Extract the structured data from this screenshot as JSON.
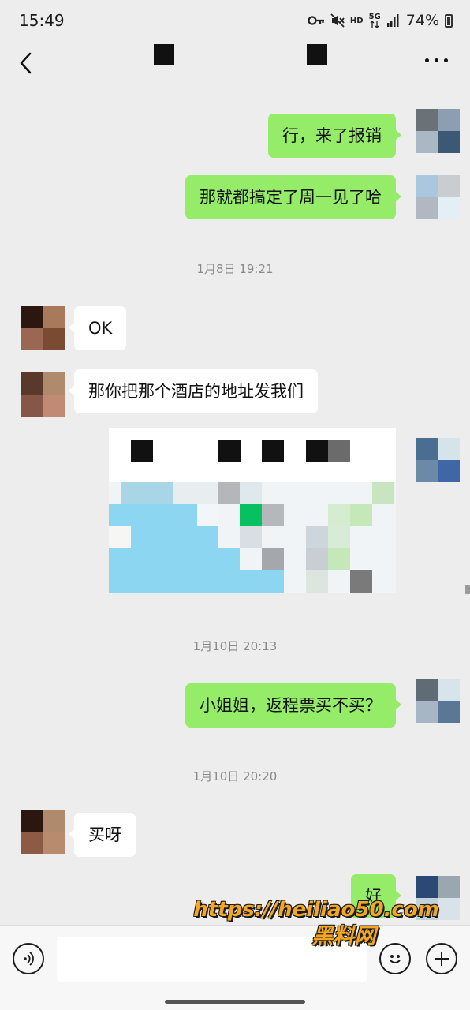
{
  "status_bar": {
    "time": "15:49",
    "network_hd": "HD",
    "network_5g": "5G",
    "battery": "74%",
    "icons": [
      "key-icon",
      "mute-icon",
      "hd-icon",
      "5g-icon",
      "signal-icon",
      "battery-icon"
    ]
  },
  "header": {
    "back_icon": "chevron-left-icon",
    "more_icon": "more-dots-icon"
  },
  "messages": [
    {
      "from": "me",
      "text": "行，来了报销"
    },
    {
      "from": "me",
      "text": "那就都搞定了周一见了哈"
    },
    {
      "type": "timestamp",
      "text": "1月8日 19:21"
    },
    {
      "from": "them",
      "text": "OK"
    },
    {
      "from": "them",
      "text": "那你把那个酒店的地址发我们"
    },
    {
      "from": "me",
      "type": "location-card"
    },
    {
      "type": "timestamp",
      "text": "1月10日 20:13"
    },
    {
      "from": "me",
      "text": "小姐姐，返程票买不买？"
    },
    {
      "type": "timestamp",
      "text": "1月10日 20:20"
    },
    {
      "from": "them",
      "text": "买呀"
    },
    {
      "from": "me",
      "text": "好"
    }
  ],
  "watermark": {
    "url": "https://heiliao50.com",
    "name": "黑料网"
  },
  "input_bar": {
    "voice_icon": "voice-icon",
    "emoji_icon": "emoji-icon",
    "plus_icon": "plus-icon",
    "input_value": ""
  },
  "colors": {
    "background": "#ededed",
    "my_bubble": "#95ec69",
    "their_bubble": "#ffffff",
    "timestamp_text": "#8a8a8a",
    "map_water": "#8dd6f2",
    "map_pin": "#07c160",
    "watermark": "#f5a623"
  }
}
